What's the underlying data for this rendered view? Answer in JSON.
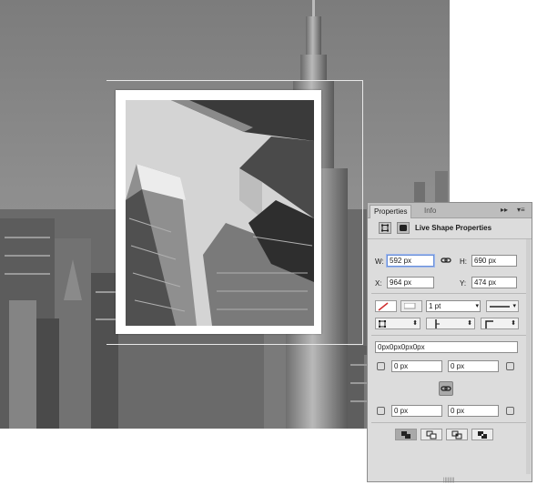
{
  "panel": {
    "tabs": {
      "properties": "Properties",
      "info": "Info"
    },
    "controls": {
      "collapse": "▸▸",
      "menu": "▾≡",
      "close": "×"
    },
    "section_title": "Live Shape Properties",
    "w_label": "W:",
    "w_value": "592 px",
    "h_label": "H:",
    "h_value": "690 px",
    "x_label": "X:",
    "x_value": "964 px",
    "y_label": "Y:",
    "y_value": "474 px",
    "stroke_width": "1 pt",
    "corner_summary": "0px0px0px0px",
    "radius_tl": "0 px",
    "radius_tr": "0 px",
    "radius_bl": "0 px",
    "radius_br": "0 px"
  },
  "icons": {
    "shape": "shape-bounds-icon",
    "mask": "mask-icon",
    "link": "link-icon",
    "fill": "fill-swatch-icon",
    "stroke": "stroke-swatch-icon"
  },
  "colors": {
    "panel_bg": "#dcdcdc",
    "focus": "#6a8fd8",
    "stroke_red": "#d03030"
  }
}
